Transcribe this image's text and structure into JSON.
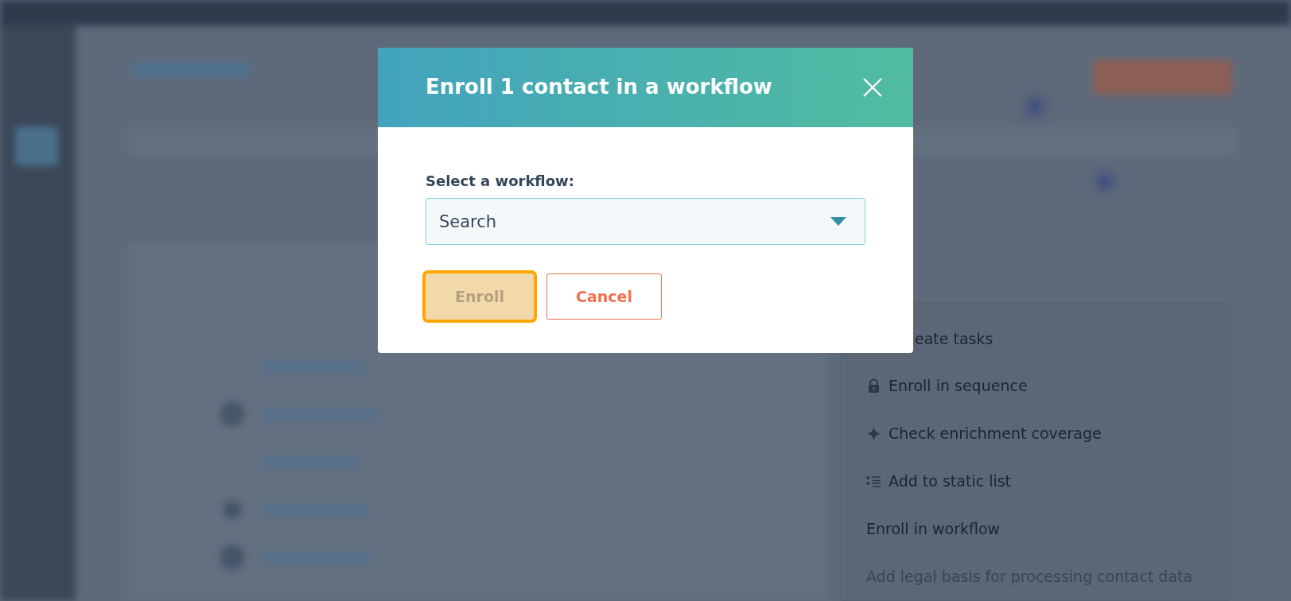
{
  "actions_menu": {
    "items": [
      {
        "label": "eate tasks",
        "kind": "plain",
        "disabled": false
      },
      {
        "label": "Enroll in sequence",
        "kind": "lock",
        "disabled": false
      },
      {
        "label": "Check enrichment coverage",
        "kind": "sparkle",
        "disabled": false
      },
      {
        "label": "Add to static list",
        "kind": "list",
        "disabled": false
      },
      {
        "label": "Enroll in workflow",
        "kind": "plain",
        "disabled": false
      },
      {
        "label": "Add legal basis for processing contact data",
        "kind": "plain",
        "disabled": true
      }
    ]
  },
  "dialog": {
    "title": "Enroll 1 contact in a workflow",
    "field_label": "Select a workflow:",
    "select": {
      "placeholder": "Search"
    },
    "buttons": [
      {
        "label": "Enroll",
        "kind": "primary",
        "disabled": true,
        "focused": true
      },
      {
        "label": "Cancel",
        "kind": "secondary",
        "disabled": false,
        "focused": false
      }
    ]
  }
}
